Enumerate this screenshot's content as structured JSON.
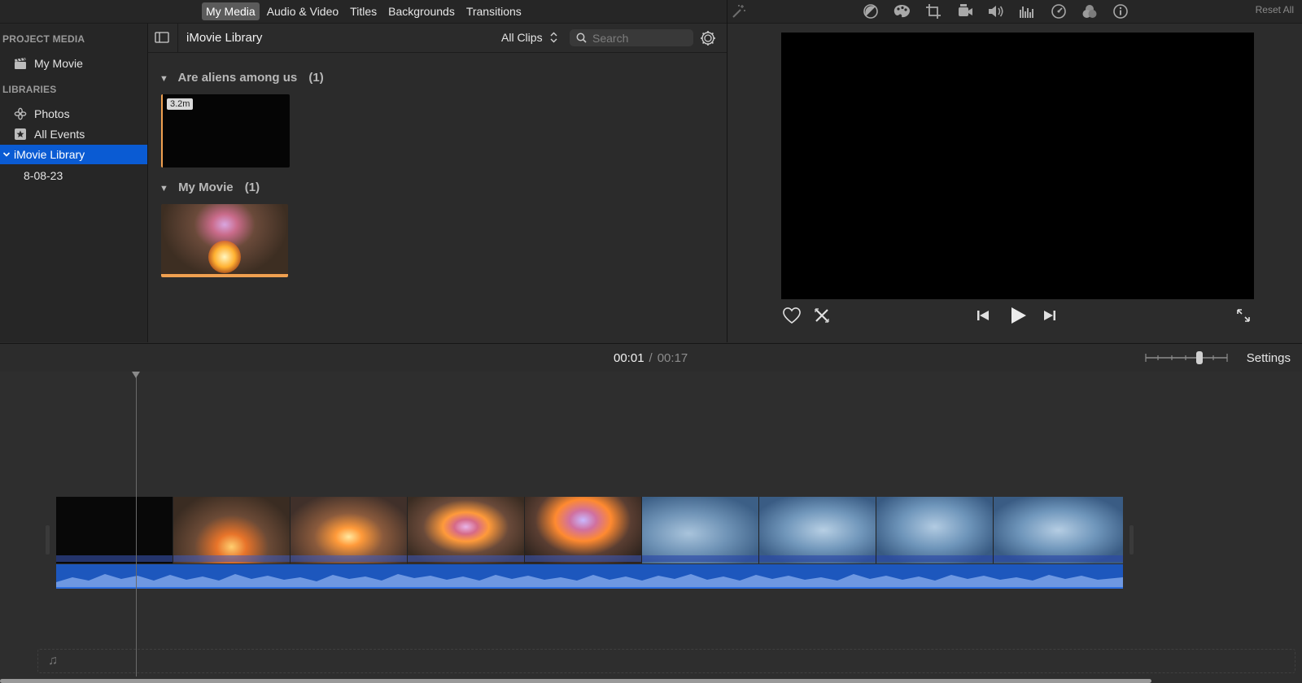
{
  "top_tabs": [
    {
      "label": "My Media",
      "active": true
    },
    {
      "label": "Audio & Video",
      "active": false
    },
    {
      "label": "Titles",
      "active": false
    },
    {
      "label": "Backgrounds",
      "active": false
    },
    {
      "label": "Transitions",
      "active": false
    }
  ],
  "toolbar": {
    "reset_all": "Reset All",
    "icons": [
      "magic-wand-icon",
      "color-balance-icon",
      "color-correction-icon",
      "crop-icon",
      "stabilization-icon",
      "volume-icon",
      "noise-reduction-equalizer-icon",
      "speed-icon",
      "clip-filter-icon",
      "info-icon"
    ]
  },
  "sidebar": {
    "project_media_header": "PROJECT MEDIA",
    "project_item": "My Movie",
    "libraries_header": "LIBRARIES",
    "items": [
      {
        "label": "Photos",
        "icon": "photos-icon"
      },
      {
        "label": "All Events",
        "icon": "star-icon"
      },
      {
        "label": "iMovie Library",
        "icon": "chevron-down-icon",
        "selected": true
      },
      {
        "label": "8-08-23"
      }
    ]
  },
  "browser": {
    "title": "iMovie Library",
    "filter": "All Clips",
    "search_placeholder": "Search",
    "events": [
      {
        "title": "Are aliens among us",
        "count": "(1)",
        "clip_duration": "3.2m"
      },
      {
        "title": "My Movie",
        "count": "(1)"
      }
    ]
  },
  "timecode": {
    "current": "00:01",
    "separator": "/",
    "total": "00:17"
  },
  "timeline": {
    "settings_label": "Settings"
  },
  "colors": {
    "accent": "#0a5bd3",
    "clip_highlight": "#f0a050",
    "audio": "#1d57bd"
  }
}
